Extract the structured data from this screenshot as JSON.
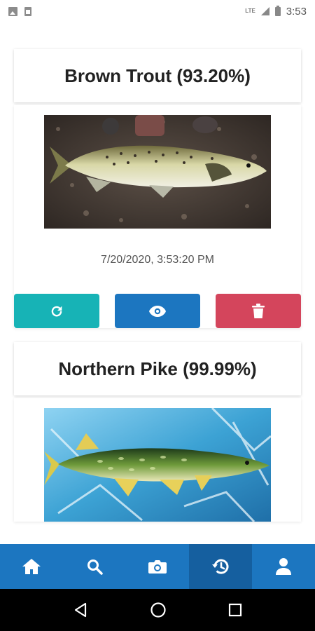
{
  "status_bar": {
    "network": "LTE",
    "time": "3:53",
    "left_icons": [
      "image-icon",
      "sim-icon"
    ]
  },
  "cards": [
    {
      "title": "Brown Trout (93.20%)",
      "timestamp": "7/20/2020, 3:53:20 PM",
      "image": "brown-trout-photo"
    },
    {
      "title": "Northern Pike (99.99%)",
      "image": "northern-pike-photo"
    }
  ],
  "card_actions": [
    "refresh-icon",
    "eye-icon",
    "trash-icon"
  ],
  "colors": {
    "primary": "#1c76c0",
    "primary_active": "#155f9f",
    "teal": "#17b3b6",
    "danger": "#d4455c"
  },
  "bottom_nav": {
    "items": [
      "home-icon",
      "search-icon",
      "camera-icon",
      "history-icon",
      "user-icon"
    ],
    "active": "history-icon"
  },
  "android_nav": [
    "back-icon",
    "home-circle-icon",
    "recents-icon"
  ]
}
